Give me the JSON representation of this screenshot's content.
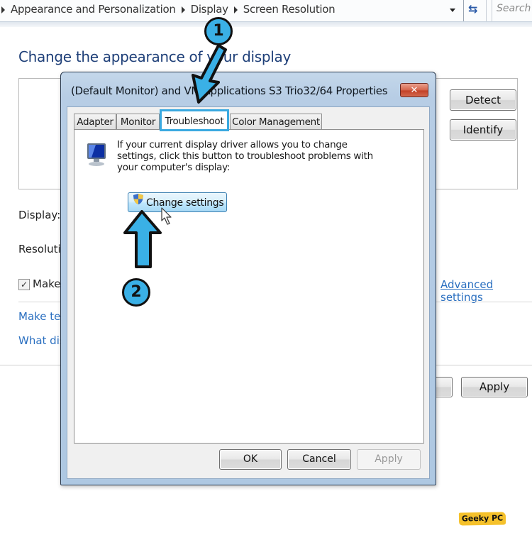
{
  "address_bar": {
    "breadcrumbs": [
      "Appearance and Personalization",
      "Display",
      "Screen Resolution"
    ],
    "search_placeholder": "Search",
    "refresh_icon": "refresh-icon",
    "dropdown_icon": "chevron-down-icon"
  },
  "page": {
    "title": "Change the appearance of your display",
    "detect_label": "Detect",
    "identify_label": "Identify",
    "display_label": "Display:",
    "resolution_label": "Resolution:",
    "make_checkbox_label": "Make",
    "make_checkbox_checked": true,
    "advanced_settings_link": "Advanced settings",
    "make_text_link": "Make text",
    "what_display_link": "What display",
    "apply_label": "Apply"
  },
  "dialog": {
    "title": "(Default Monitor) and VM Applications S3 Trio32/64 Properties",
    "close_label": "✕",
    "tabs": [
      {
        "label": "Adapter",
        "active": false
      },
      {
        "label": "Monitor",
        "active": false
      },
      {
        "label": "Troubleshoot",
        "active": true
      },
      {
        "label": "Color Management",
        "active": false
      }
    ],
    "description": "If your current display driver allows you to change settings, click this button to troubleshoot problems with your computer's display:",
    "change_settings_label": "Change settings",
    "ok_label": "OK",
    "cancel_label": "Cancel",
    "apply_label": "Apply",
    "apply_disabled": true
  },
  "annotations": {
    "step1": "1",
    "step2": "2",
    "highlight_color": "#3aa9e0"
  },
  "watermark": "Geeky PC"
}
